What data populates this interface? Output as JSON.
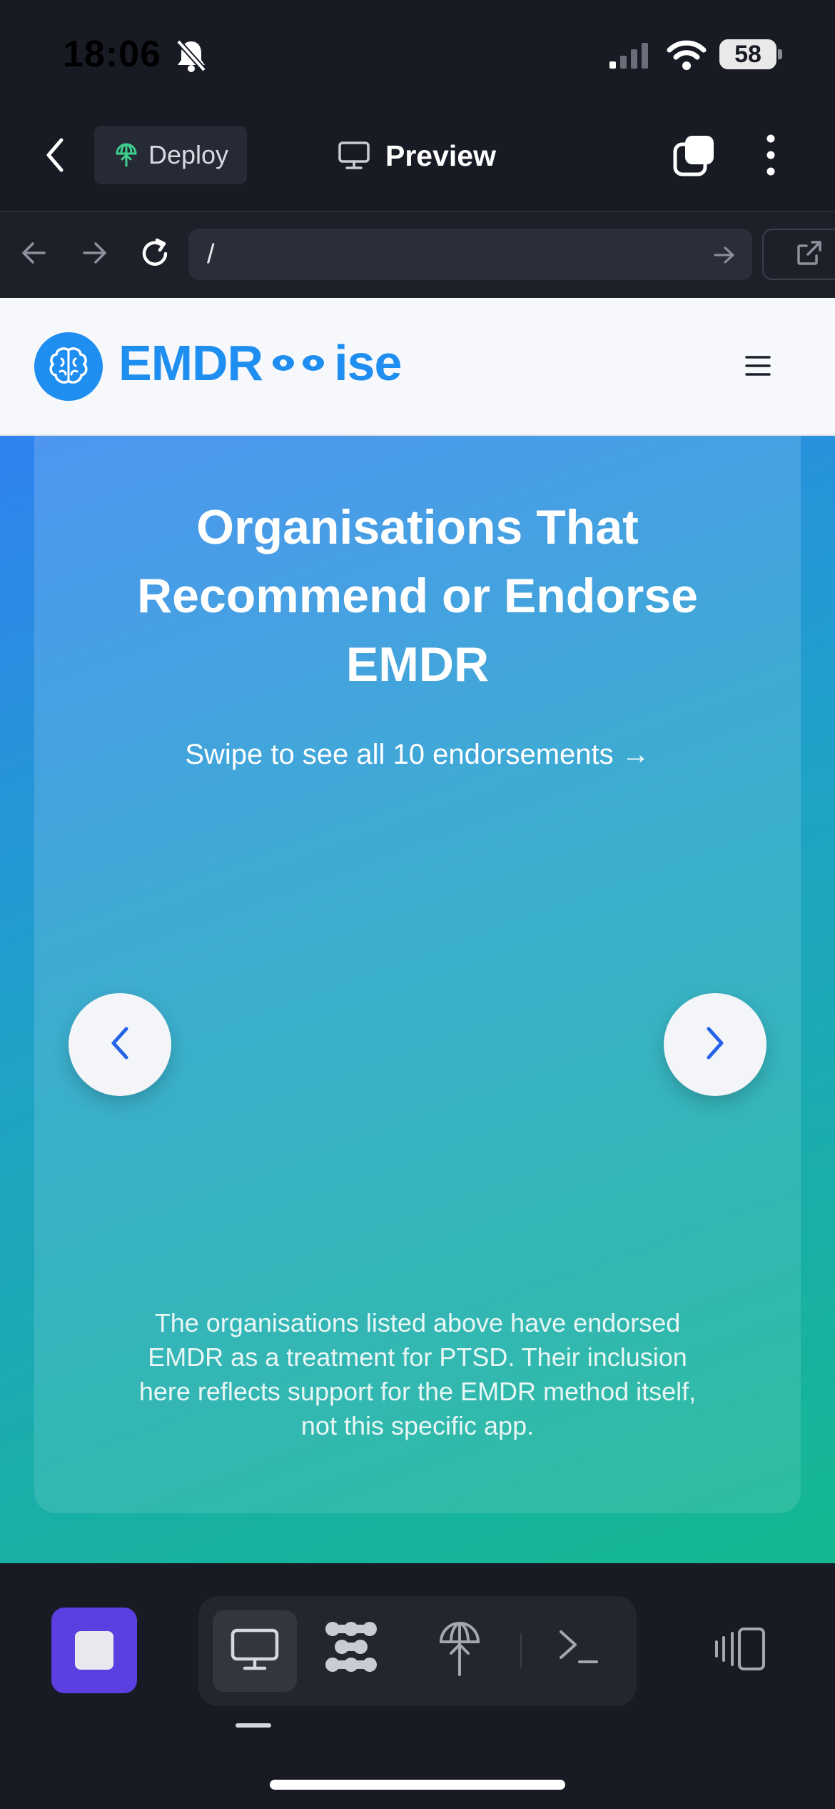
{
  "status_bar": {
    "time": "18:06",
    "battery": "58",
    "icons": [
      "bell-slash-icon",
      "signal-icon",
      "wifi-icon",
      "battery-icon"
    ]
  },
  "top_nav": {
    "deploy_label": "Deploy",
    "preview_label": "Preview",
    "icons": [
      "back-chevron-icon",
      "deploy-icon",
      "monitor-icon",
      "tabs-icon",
      "kebab-icon"
    ]
  },
  "url_bar": {
    "value": "/"
  },
  "site_header": {
    "logo_left": "EMDR",
    "logo_right": "ise"
  },
  "card": {
    "title": "Organisations That Recommend or Endorse EMDR",
    "subtitle": "Swipe to see all 10 endorsements →",
    "disclaimer": "The organisations listed above have endorsed EMDR as a treatment for PTSD. Their inclusion here reflects support for the EMDR method itself, not this specific app."
  },
  "colors": {
    "brand_blue": "#1f8ef1",
    "accent_purple": "#5b3fe0",
    "gradient_start": "#2f83f0",
    "gradient_end": "#14b88f"
  }
}
